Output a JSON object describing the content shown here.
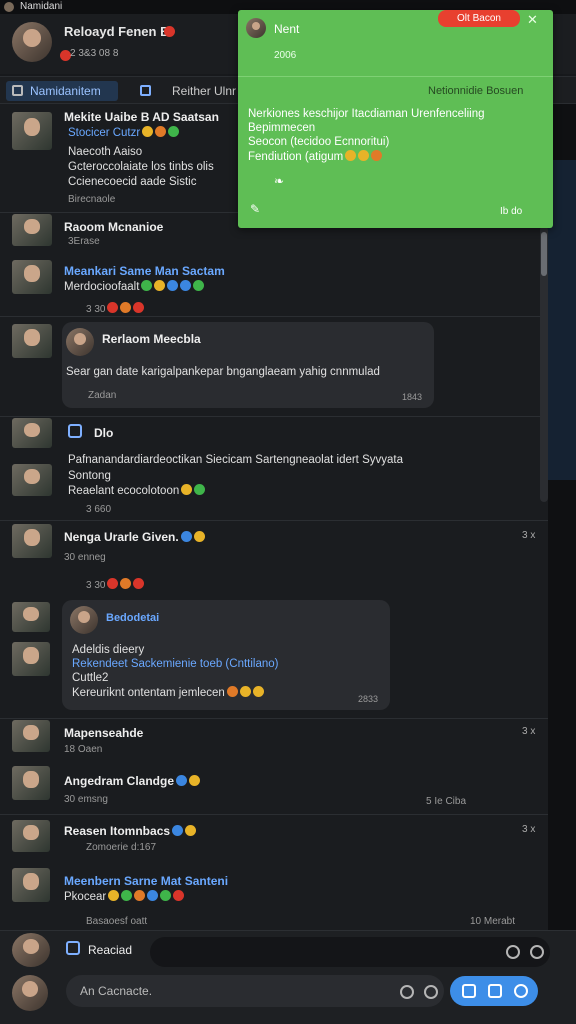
{
  "window": {
    "title": "Namidani"
  },
  "header": {
    "name": "Reloayd Fenen B",
    "sub": "2 3&3 08 8"
  },
  "tabs": [
    {
      "label": "Namidanitem"
    },
    {
      "label": "Reither Ulnr"
    }
  ],
  "popup": {
    "title": "Nent",
    "subtitle": "2006",
    "close_label": "Olt Bacon",
    "selector": "Netionnidie Bosuen",
    "lines": [
      "Nerkiones keschijor Itacdiaman Urenfenceliing",
      "Bepimmecen",
      "Seocon (tecidoo Ecnnoritui)",
      "Fendiution (atigum"
    ],
    "footer": "Ib do"
  },
  "messages": [
    {
      "name": "Mekite Uaibe B AD Saatsan",
      "line1": "Stocicer Cutzr",
      "line2": "Naecoth Aaiso",
      "line3": "Gcteroccolaiate los tinbs olis",
      "line4": "Ccienecoecid aade Sistic",
      "meta": "Birecnaole"
    },
    {
      "name": "Raoom Mcnanioe",
      "meta": "3Erase"
    },
    {
      "name": "Meankari Same Man Sactam",
      "line1": "Merdocioofaalt",
      "meta": "3 30"
    },
    {
      "card_name": "Rerlaom Meecbla",
      "card_text": "Sear gan date karigalpankepar bnganglaeam yahig cnnmulad",
      "card_meta": "Zadan",
      "card_time": "1843"
    },
    {
      "name": "Dlo"
    },
    {
      "name": "Pafnanandardiardeoctikan Siecicam Sartengneaolat idert Syvyata",
      "line1": "Sontong",
      "line2": "Reaelant ecocolotoon",
      "meta": "3 660"
    },
    {
      "name": "Nenga Urarle Given.",
      "meta": "30 enneg",
      "meta2": "3 30",
      "close": "3 x"
    },
    {
      "card_name": "Bedodetai",
      "card_line1": "Adeldis dieery",
      "card_line2": "Rekendeet Sackemienie toeb (Cnttilano)",
      "card_line3": "Cuttle2",
      "card_line4": "Kereuriknt ontentam jemlecen",
      "card_time": "2833"
    },
    {
      "name": "Mapenseahde",
      "meta": "18 Oaen",
      "close": "3 x"
    },
    {
      "name": "Angedram Clandge",
      "meta": "30 emsng",
      "meta_right": "5 Ie Ciba"
    },
    {
      "name": "Reasen Itomnbacs",
      "meta": "Zomoerie d:167",
      "close": "3 x"
    },
    {
      "name": "Meenbern Sarne Mat Santeni",
      "line1": "Pkocear",
      "meta": "Basaoesf oatt",
      "meta_right": "10 Merabt"
    }
  ],
  "composer": {
    "reply_label": "Reaciad",
    "placeholder": "An Cacnacte."
  },
  "colors": {
    "accent": "#3d8ee8",
    "popup": "#5fbe55",
    "danger": "#e8402f"
  }
}
